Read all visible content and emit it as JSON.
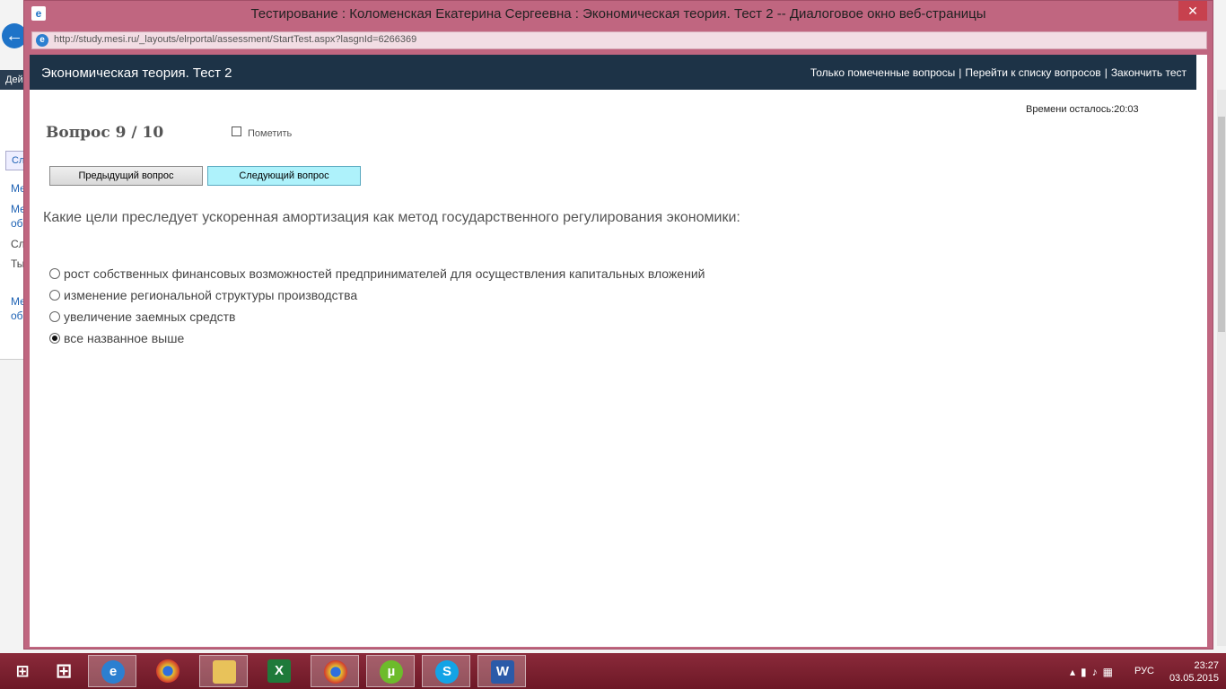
{
  "dialog": {
    "title": "Тестирование : Коломенская Екатерина Сергеевна : Экономическая теория. Тест 2 -- Диалоговое окно веб-страницы",
    "close_label": "✕",
    "url": "http://study.mesi.ru/_layouts/elrportal/assessment/StartTest.aspx?lasgnId=6266369"
  },
  "header": {
    "title": "Экономическая теория. Тест 2",
    "links": [
      "Только помеченные вопросы",
      "Перейти к списку вопросов",
      "Закончить тест"
    ],
    "separator": "|"
  },
  "timer": {
    "text": "Времени осталось:20:03"
  },
  "question": {
    "number_label": "Вопрос 9 / 10",
    "mark_label": "Пометить",
    "mark_checked": false,
    "prev_label": "Предыдущий вопрос",
    "next_label": "Следующий вопрос",
    "text": "Какие цели преследует ускоренная амортизация как метод государственного регулирования экономики:",
    "options": [
      {
        "label": "рост собственных финансовых возможностей предпринимателей для осуществления капитальных вложений",
        "selected": false
      },
      {
        "label": "изменение региональной структуры производства",
        "selected": false
      },
      {
        "label": "увеличение заемных средств",
        "selected": false
      },
      {
        "label": "все названное выше",
        "selected": true
      }
    ]
  },
  "background": {
    "nav_label": "Дей",
    "tab_label": "Сл",
    "side_texts": [
      "Ме",
      "Ме",
      "об",
      "Сл",
      "Ты",
      "Ме",
      "об"
    ]
  },
  "taskbar": {
    "apps": [
      {
        "icon": "start-icon"
      },
      {
        "icon": "windows-icon"
      },
      {
        "icon": "internet-explorer-icon",
        "active": true
      },
      {
        "icon": "chrome-icon"
      },
      {
        "icon": "file-explorer-icon"
      },
      {
        "icon": "excel-icon"
      },
      {
        "icon": "chrome-icon"
      },
      {
        "icon": "utorrent-icon"
      },
      {
        "icon": "skype-icon"
      },
      {
        "icon": "word-icon"
      }
    ],
    "language": "РУС",
    "time": "23:27",
    "date": "03.05.2015"
  },
  "colors": {
    "dialog_frame": "#c06680",
    "header_bg": "#1d3347",
    "next_button_bg": "#aef2fb",
    "taskbar_bg": "#7a1f2e"
  }
}
